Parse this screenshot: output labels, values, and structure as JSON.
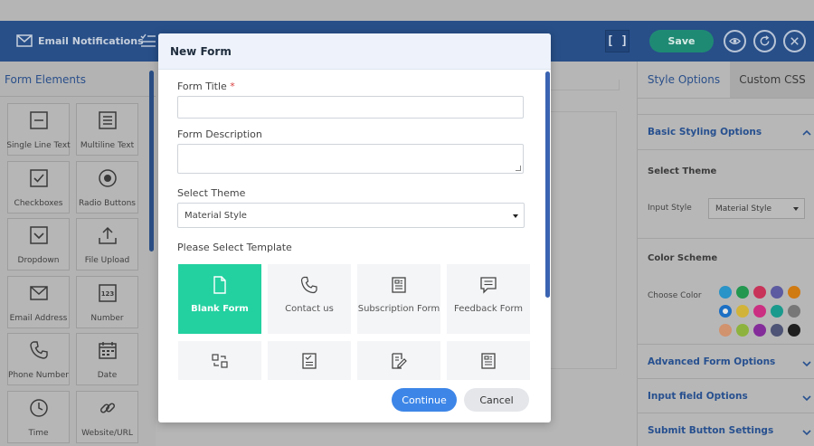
{
  "header": {
    "email_notifications": "Email Notifications",
    "fullscreen": "[ ]",
    "save": "Save"
  },
  "left_panel": {
    "title": "Form Elements",
    "elements": [
      {
        "label": "Single Line Text",
        "icon": "single-line-text-icon"
      },
      {
        "label": "Multiline Text",
        "icon": "multiline-text-icon"
      },
      {
        "label": "Checkboxes",
        "icon": "checkbox-icon"
      },
      {
        "label": "Radio Buttons",
        "icon": "radio-button-icon"
      },
      {
        "label": "Dropdown",
        "icon": "dropdown-icon"
      },
      {
        "label": "File Upload",
        "icon": "upload-icon"
      },
      {
        "label": "Email Address",
        "icon": "email-icon"
      },
      {
        "label": "Number",
        "icon": "number-icon"
      },
      {
        "label": "Phone Number",
        "icon": "phone-icon"
      },
      {
        "label": "Date",
        "icon": "calendar-icon"
      },
      {
        "label": "Time",
        "icon": "clock-icon"
      },
      {
        "label": "Website/URL",
        "icon": "link-icon"
      }
    ]
  },
  "right_panel": {
    "tabs": [
      "Style Options",
      "Custom CSS"
    ],
    "basic_styling": "Basic Styling Options",
    "select_theme": "Select Theme",
    "input_style_label": "Input Style",
    "input_style_value": "Material Style",
    "color_scheme": "Color Scheme",
    "choose_color": "Choose Color",
    "swatches": [
      "#2a93c7",
      "#23974f",
      "#c83359",
      "#5c5aa0",
      "#d07a12",
      "#1b6fc4",
      "#d1b33a",
      "#cb2f81",
      "#1a9a8c",
      "#777777",
      "#d1926e",
      "#8db33e",
      "#842d9a",
      "#4d5475",
      "#1f1f1f"
    ],
    "advanced": "Advanced Form Options",
    "input_field": "Input field Options",
    "submit_button": "Submit Button Settings"
  },
  "modal": {
    "title": "New Form",
    "form_title_label": "Form Title",
    "required_mark": "*",
    "form_title_value": "",
    "form_description_label": "Form Description",
    "form_description_value": "",
    "select_theme_label": "Select Theme",
    "theme_value": "Material Style",
    "template_label": "Please Select Template",
    "templates": [
      {
        "label": "Blank Form",
        "icon": "document-icon",
        "selected": true
      },
      {
        "label": "Contact us",
        "icon": "phone-icon"
      },
      {
        "label": "Subscription Form",
        "icon": "newspaper-icon"
      },
      {
        "label": "Feedback Form",
        "icon": "feedback-icon"
      },
      {
        "label": "",
        "icon": "transfer-icon"
      },
      {
        "label": "",
        "icon": "checklist-icon"
      },
      {
        "label": "",
        "icon": "document-edit-icon"
      },
      {
        "label": "",
        "icon": "newspaper-icon"
      }
    ],
    "continue": "Continue",
    "cancel": "Cancel"
  },
  "colors": {
    "header_bg": "#284f88",
    "accent_green": "#23d1a0",
    "primary_blue": "#3d86e8"
  }
}
